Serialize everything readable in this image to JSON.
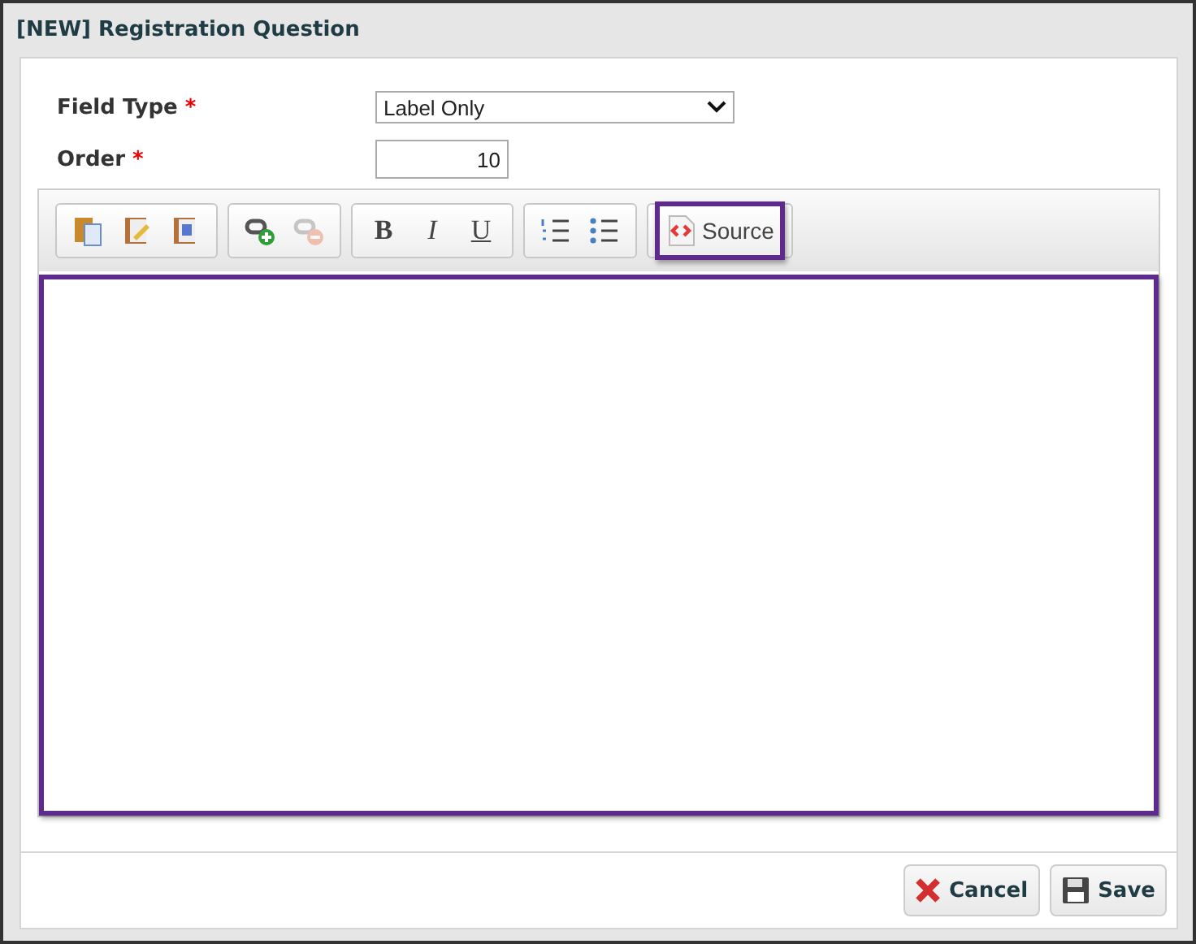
{
  "window": {
    "title": "[NEW] Registration Question"
  },
  "fields": [
    {
      "label": "Field Type",
      "required": "*",
      "kind": "select",
      "value": "Label Only"
    },
    {
      "label": "Order",
      "required": "*",
      "kind": "number",
      "value": "10"
    }
  ],
  "toolbar": [
    {
      "buttons": [
        {
          "kind": "paste",
          "disabled": false
        },
        {
          "kind": "paste-text",
          "disabled": false
        },
        {
          "kind": "paste-word",
          "disabled": false
        }
      ]
    },
    {
      "buttons": [
        {
          "kind": "link",
          "disabled": false
        },
        {
          "kind": "unlink",
          "disabled": true
        }
      ]
    },
    {
      "buttons": [
        {
          "kind": "bold",
          "label": "B",
          "disabled": false
        },
        {
          "kind": "italic",
          "label": "I",
          "disabled": false
        },
        {
          "kind": "underline",
          "label": "U",
          "disabled": false
        }
      ]
    },
    {
      "buttons": [
        {
          "kind": "numbered-list",
          "disabled": false
        },
        {
          "kind": "bulleted-list",
          "disabled": false
        }
      ]
    },
    {
      "buttons": [
        {
          "kind": "source",
          "label": "Source",
          "disabled": false,
          "highlighted": true
        }
      ]
    }
  ],
  "editor": {
    "highlighted": true
  },
  "buttons": [
    {
      "kind": "cancel",
      "label": "Cancel"
    },
    {
      "kind": "save",
      "label": "Save"
    }
  ]
}
